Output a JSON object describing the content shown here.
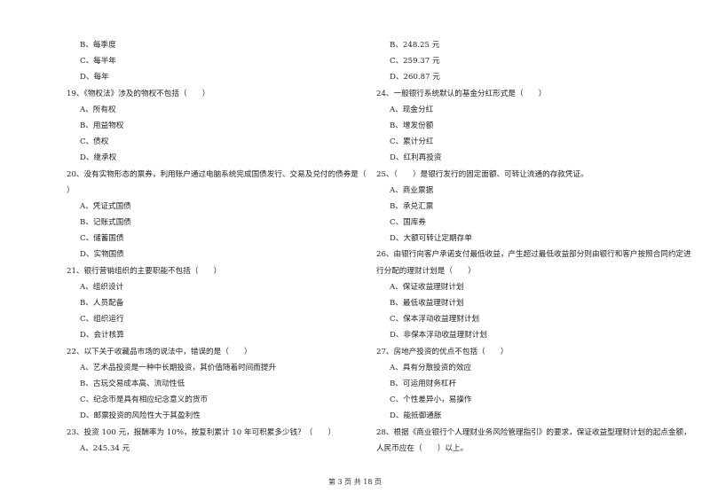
{
  "left_column": [
    {
      "kind": "option",
      "text": "B、每季度"
    },
    {
      "kind": "option",
      "text": "C、每半年"
    },
    {
      "kind": "option",
      "text": "D、每年"
    },
    {
      "kind": "question",
      "text": "19、《物权法》涉及的物权不包括（　　）"
    },
    {
      "kind": "option",
      "text": "A、所有权"
    },
    {
      "kind": "option",
      "text": "B、用益物权"
    },
    {
      "kind": "option",
      "text": "C、债权"
    },
    {
      "kind": "option",
      "text": "D、继承权"
    },
    {
      "kind": "question",
      "text": "20、没有实物形态的票券，利用账户通过电脑系统完成国债发行、交易及兑付的债券是（"
    },
    {
      "kind": "question",
      "text": "）"
    },
    {
      "kind": "option",
      "text": "A、凭证式国债"
    },
    {
      "kind": "option",
      "text": "B、记账式国债"
    },
    {
      "kind": "option",
      "text": "C、储蓄国债"
    },
    {
      "kind": "option",
      "text": "D、实物国债"
    },
    {
      "kind": "question",
      "text": "21、银行营销组织的主要职能不包括（　　）"
    },
    {
      "kind": "option",
      "text": "A、组织设计"
    },
    {
      "kind": "option",
      "text": "B、人员配备"
    },
    {
      "kind": "option",
      "text": "C、组织运行"
    },
    {
      "kind": "option",
      "text": "D、会计核算"
    },
    {
      "kind": "question",
      "text": "22、以下关于收藏品市场的说法中，错误的是（　　）"
    },
    {
      "kind": "option",
      "text": "A、艺术品投资是一种中长期投资，其价值随着时间而提升"
    },
    {
      "kind": "option",
      "text": "B、古玩交易成本高、流动性低"
    },
    {
      "kind": "option",
      "text": "C、纪念币是具有相应纪念意义的货币"
    },
    {
      "kind": "option",
      "text": "D、邮票投资的风险性大于其盈利性"
    },
    {
      "kind": "question",
      "text": "23、投资 100 元，报酬率为 10%，按复利累计 10 年可积累多少钱？（　　）"
    },
    {
      "kind": "option",
      "text": "A、245.34 元"
    }
  ],
  "right_column": [
    {
      "kind": "option",
      "text": "B、248.25 元"
    },
    {
      "kind": "option",
      "text": "C、259.37 元"
    },
    {
      "kind": "option",
      "text": "D、260.87 元"
    },
    {
      "kind": "question",
      "text": "24、一般银行系统默认的基金分红形式是（　　）"
    },
    {
      "kind": "option",
      "text": "A、现金分红"
    },
    {
      "kind": "option",
      "text": "B、增发份额"
    },
    {
      "kind": "option",
      "text": "C、累计分红"
    },
    {
      "kind": "option",
      "text": "D、红利再投资"
    },
    {
      "kind": "question",
      "text": "25、（　　）是银行发行的固定面额、可转让流通的存款凭证。"
    },
    {
      "kind": "option",
      "text": "A、商业票据"
    },
    {
      "kind": "option",
      "text": "B、承兑汇票"
    },
    {
      "kind": "option",
      "text": "C、国库券"
    },
    {
      "kind": "option",
      "text": "D、大额可转让定期存单"
    },
    {
      "kind": "question",
      "text": "26、由银行向客户承诺支付最低收益，产生超过最低收益部分则由银行和客户按照合同约定进"
    },
    {
      "kind": "question",
      "text": "行分配的理财计划是（　　）"
    },
    {
      "kind": "option",
      "text": "A、保证收益理财计划"
    },
    {
      "kind": "option",
      "text": "B、最低收益理财计划"
    },
    {
      "kind": "option",
      "text": "C、保本浮动收益理财计划"
    },
    {
      "kind": "option",
      "text": "D、非保本浮动收益理财计划"
    },
    {
      "kind": "question",
      "text": "27、房地产投资的优点不包括（　　）"
    },
    {
      "kind": "option",
      "text": "A、具有分散投资的效应"
    },
    {
      "kind": "option",
      "text": "B、可运用财务杠杆"
    },
    {
      "kind": "option",
      "text": "C、个性差异小，易操作"
    },
    {
      "kind": "option",
      "text": "D、能抵御通胀"
    },
    {
      "kind": "question",
      "text": "28、根据《商业银行个人理财业务风险管理指引》的要求，保证收益型理财计划的起点金额，"
    },
    {
      "kind": "question",
      "text": "人民币应在（　　）以上。"
    }
  ],
  "footer": {
    "page_label": "第 3 页 共 18 页"
  }
}
